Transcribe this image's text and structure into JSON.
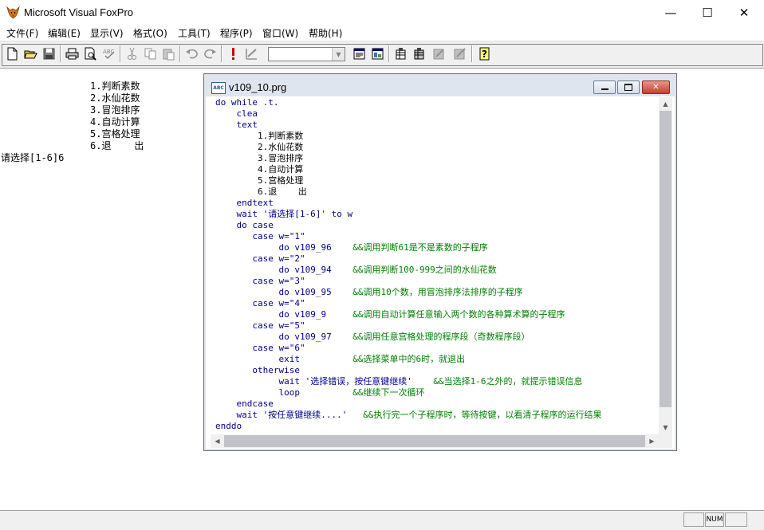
{
  "window": {
    "title": "Microsoft Visual FoxPro",
    "minimize": "—",
    "maximize": "☐",
    "close": "✕"
  },
  "menu": [
    {
      "label": "文件(F)"
    },
    {
      "label": "编辑(E)"
    },
    {
      "label": "显示(V)"
    },
    {
      "label": "格式(O)"
    },
    {
      "label": "工具(T)"
    },
    {
      "label": "程序(P)"
    },
    {
      "label": "窗口(W)"
    },
    {
      "label": "帮助(H)"
    }
  ],
  "toolbar": {
    "icons": [
      "new-icon",
      "open-icon",
      "save-icon",
      "print-icon",
      "print-preview-icon",
      "spell-check-icon",
      "cut-icon",
      "copy-icon",
      "paste-icon",
      "undo-icon",
      "redo-icon",
      "run-icon",
      "modify-form-icon",
      "data-session-icon",
      "form-wizard-icon",
      "command-window-icon",
      "view-window-icon",
      "database-designer-icon",
      "help-icon"
    ],
    "combo_value": ""
  },
  "desktop_output": {
    "menu_lines": [
      "1.判断素数",
      "2.水仙花数",
      "3.冒泡排序",
      "4.自动计算",
      "5.宫格处理",
      "6.退    出"
    ],
    "prompt_line": "请选择[1-6]6"
  },
  "editor": {
    "title": "v109_10.prg",
    "icon_label": "ABC",
    "lines": [
      {
        "indent": 0,
        "code": "do while .t.",
        "comment": ""
      },
      {
        "indent": 4,
        "code": "clea",
        "comment": ""
      },
      {
        "indent": 4,
        "code": "text",
        "comment": ""
      },
      {
        "indent": 8,
        "code": "1.判断素数",
        "comment": ""
      },
      {
        "indent": 8,
        "code": "2.水仙花数",
        "comment": ""
      },
      {
        "indent": 8,
        "code": "3.冒泡排序",
        "comment": ""
      },
      {
        "indent": 8,
        "code": "4.自动计算",
        "comment": ""
      },
      {
        "indent": 8,
        "code": "5.宫格处理",
        "comment": ""
      },
      {
        "indent": 8,
        "code": "6.退    出",
        "comment": ""
      },
      {
        "indent": 4,
        "code": "endtext",
        "comment": ""
      },
      {
        "indent": 4,
        "code": "wait '请选择[1-6]' to w",
        "comment": ""
      },
      {
        "indent": 4,
        "code": "do case",
        "comment": ""
      },
      {
        "indent": 7,
        "code": "case w=\"1\"",
        "comment": ""
      },
      {
        "indent": 12,
        "code": "do v109_96    ",
        "comment": "&&调用判断61是不是素数的子程序"
      },
      {
        "indent": 7,
        "code": "case w=\"2\"",
        "comment": ""
      },
      {
        "indent": 12,
        "code": "do v109_94    ",
        "comment": "&&调用判断100-999之间的水仙花数"
      },
      {
        "indent": 7,
        "code": "case w=\"3\"",
        "comment": ""
      },
      {
        "indent": 12,
        "code": "do v109_95    ",
        "comment": "&&调用10个数，用冒泡排序法排序的子程序"
      },
      {
        "indent": 7,
        "code": "case w=\"4\"",
        "comment": ""
      },
      {
        "indent": 12,
        "code": "do v109_9     ",
        "comment": "&&调用自动计算任意输入两个数的各种算术算的子程序"
      },
      {
        "indent": 7,
        "code": "case w=\"5\"",
        "comment": ""
      },
      {
        "indent": 12,
        "code": "do v109_97    ",
        "comment": "&&调用任意宫格处理的程序段（奇数程序段）"
      },
      {
        "indent": 7,
        "code": "case w=\"6\"",
        "comment": ""
      },
      {
        "indent": 12,
        "code": "exit          ",
        "comment": "&&选择菜单中的6时，就退出"
      },
      {
        "indent": 7,
        "code": "otherwise",
        "comment": ""
      },
      {
        "indent": 12,
        "code": "wait '选择错误，按任意键继续'    ",
        "comment": "&&当选择1-6之外的，就提示错误信息"
      },
      {
        "indent": 12,
        "code": "loop          ",
        "comment": "&&继续下一次循环"
      },
      {
        "indent": 4,
        "code": "endcase",
        "comment": ""
      },
      {
        "indent": 4,
        "code": "wait '按任意键继续....'   ",
        "comment": "&&执行完一个子程序时，等待按键，以看清子程序的运行结果"
      },
      {
        "indent": 0,
        "code": "enddo",
        "comment": ""
      }
    ]
  },
  "statusbar": {
    "num": "NUM"
  }
}
